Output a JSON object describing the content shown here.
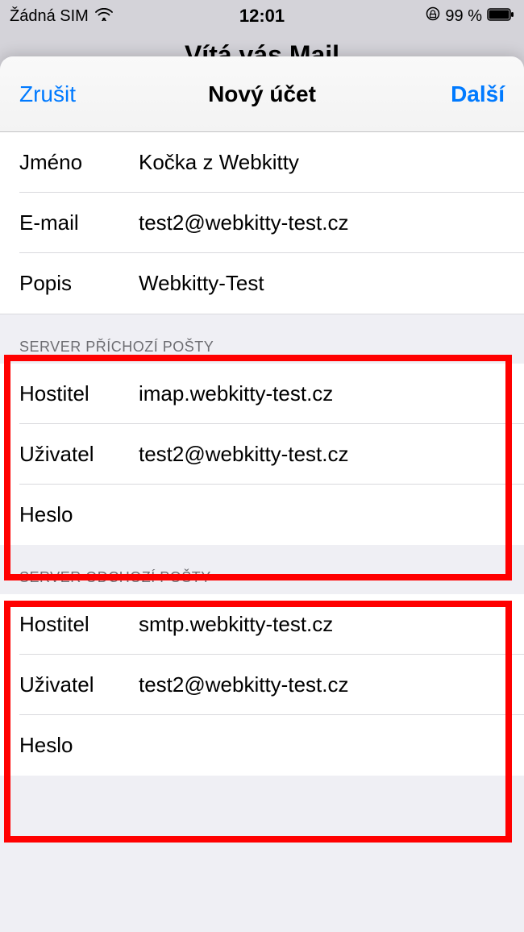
{
  "status_bar": {
    "carrier": "Žádná SIM",
    "time": "12:01",
    "battery_text": "99 %"
  },
  "background_title": "Vítá vás Mail",
  "navbar": {
    "cancel": "Zrušit",
    "title": "Nový účet",
    "next": "Další"
  },
  "account": {
    "name_label": "Jméno",
    "name_value": "Kočka z Webkitty",
    "email_label": "E-mail",
    "email_value": "test2@webkitty-test.cz",
    "desc_label": "Popis",
    "desc_value": "Webkitty-Test"
  },
  "incoming": {
    "header": "SERVER PŘÍCHOZÍ POŠTY",
    "host_label": "Hostitel",
    "host_value": "imap.webkitty-test.cz",
    "user_label": "Uživatel",
    "user_value": "test2@webkitty-test.cz",
    "pass_label": "Heslo",
    "pass_value": ""
  },
  "outgoing": {
    "header": "SERVER ODCHOZÍ POŠTY",
    "host_label": "Hostitel",
    "host_value": "smtp.webkitty-test.cz",
    "user_label": "Uživatel",
    "user_value": "test2@webkitty-test.cz",
    "pass_label": "Heslo",
    "pass_value": ""
  }
}
